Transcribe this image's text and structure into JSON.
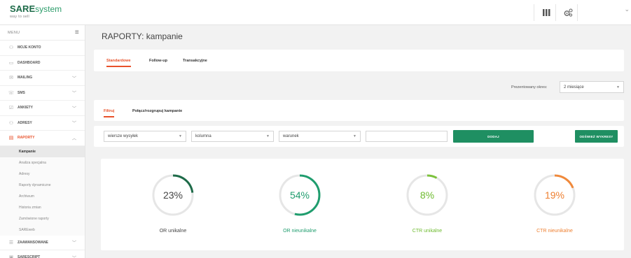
{
  "brand": {
    "name_bold": "SARE",
    "name_light": "system",
    "tagline": "way to sell"
  },
  "sidebar": {
    "menu_label": "MENU",
    "items": [
      {
        "label": "MOJE KONTO",
        "icon": "user-icon",
        "has_children": false
      },
      {
        "label": "DASHBOARD",
        "icon": "monitor-icon",
        "has_children": false
      },
      {
        "label": "MAILING",
        "icon": "envelope-icon",
        "has_children": true
      },
      {
        "label": "SMS",
        "icon": "phone-icon",
        "has_children": true
      },
      {
        "label": "ANKIETY",
        "icon": "checklist-icon",
        "has_children": true
      },
      {
        "label": "ADRESY",
        "icon": "user-icon",
        "has_children": true
      },
      {
        "label": "RAPORTY",
        "icon": "report-icon",
        "has_children": true,
        "active": true
      }
    ],
    "subitems": [
      "Kampanie",
      "Analiza specjalna",
      "Adresy",
      "Raporty dynamiczne",
      "Archiwum",
      "Historia zmian",
      "Zamówione raporty",
      "SAREweb"
    ],
    "items_after": [
      {
        "label": "ZAAWANSOWANE",
        "icon": "list-icon",
        "has_children": true
      },
      {
        "label": "SARESCRIPT",
        "icon": "code-icon",
        "has_children": true
      }
    ]
  },
  "page": {
    "title": "RAPORTY: kampanie"
  },
  "tabs_main": [
    "Standardowe",
    "Follow-up",
    "Transakcyjne"
  ],
  "period": {
    "label": "Prezentowany okres:",
    "value": "2 miesiące"
  },
  "tabs_filter": [
    "Filtruj",
    "Połącz/rozgrupuj kampanie"
  ],
  "filters": {
    "select1": "wiersze wysyłek",
    "select2": "kolumna",
    "select3": "warunek",
    "text_value": "",
    "add_button": "DODAJ",
    "refresh_button": "ODŚWIEŻ WYKRESY"
  },
  "stats": [
    {
      "value": 23,
      "label_pct": "23%",
      "name": "OR unikalne",
      "color": "#1e6b49",
      "label_color": "#444"
    },
    {
      "value": 54,
      "label_pct": "54%",
      "name": "OR nieunikalne",
      "color": "#1f9d6e",
      "label_color": "#1f9d6e"
    },
    {
      "value": 8,
      "label_pct": "8%",
      "name": "CTR unikalne",
      "color": "#7cc23b",
      "label_color": "#6dbb2e"
    },
    {
      "value": 19,
      "label_pct": "19%",
      "name": "CTR nieunikalne",
      "color": "#f0893b",
      "label_color": "#ee7f30"
    }
  ]
}
